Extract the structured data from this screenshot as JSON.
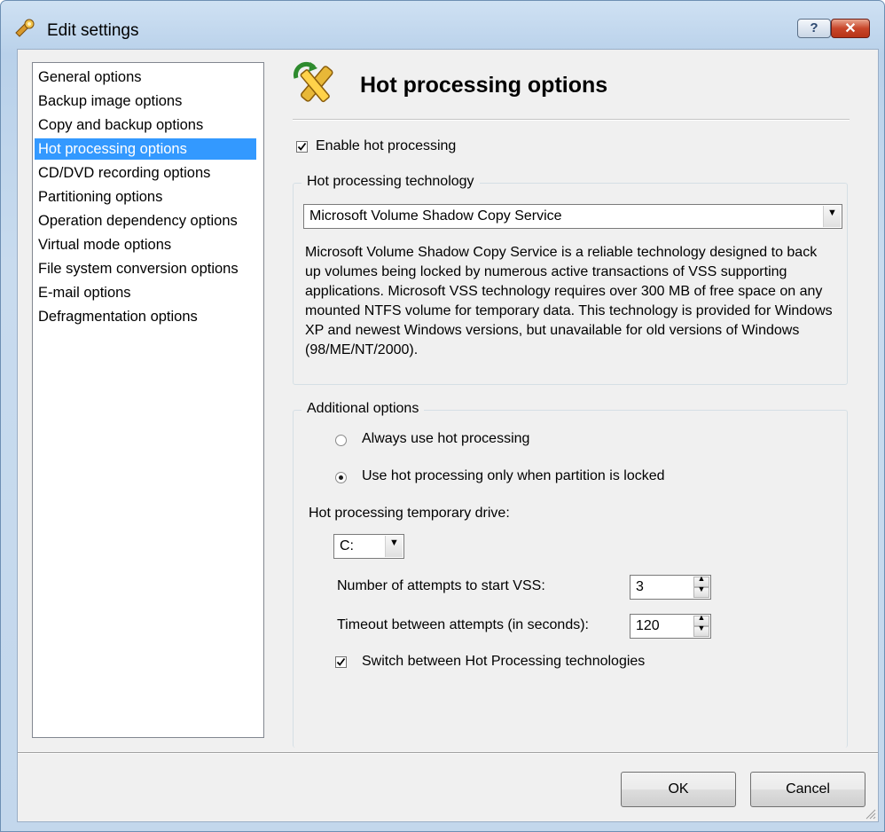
{
  "window": {
    "title": "Edit settings",
    "help_label": "?",
    "close_label": "✕"
  },
  "nav": {
    "items": [
      {
        "label": "General options",
        "selected": false
      },
      {
        "label": "Backup image options",
        "selected": false
      },
      {
        "label": "Copy and backup options",
        "selected": false
      },
      {
        "label": "Hot processing options",
        "selected": true
      },
      {
        "label": "CD/DVD recording options",
        "selected": false
      },
      {
        "label": "Partitioning options",
        "selected": false
      },
      {
        "label": "Operation dependency options",
        "selected": false
      },
      {
        "label": "Virtual mode options",
        "selected": false
      },
      {
        "label": "File system conversion options",
        "selected": false
      },
      {
        "label": "E-mail options",
        "selected": false
      },
      {
        "label": "Defragmentation options",
        "selected": false
      }
    ]
  },
  "header": {
    "title": "Hot processing options",
    "icon": "tools-wrench-pencil-icon"
  },
  "enable_hot_processing": {
    "label": "Enable hot processing",
    "checked": true
  },
  "technology": {
    "group_title": "Hot processing technology",
    "selected": "Microsoft Volume Shadow Copy Service",
    "description": "Microsoft Volume Shadow Copy Service is a reliable technology designed to back up volumes being locked by numerous active transactions of VSS supporting applications. Microsoft VSS technology requires over 300 MB of free space on any mounted NTFS volume for temporary data. This technology is provided for Windows XP and newest Windows versions, but unavailable for old versions of Windows (98/ME/NT/2000)."
  },
  "additional": {
    "group_title": "Additional options",
    "radio_always": {
      "label": "Always use hot processing",
      "selected": false
    },
    "radio_locked": {
      "label": "Use hot processing only when partition is locked",
      "selected": true
    },
    "temp_drive_label": "Hot processing temporary drive:",
    "temp_drive_value": "C:",
    "attempts_label": "Number of attempts to start VSS:",
    "attempts_value": "3",
    "timeout_label": "Timeout between attempts (in seconds):",
    "timeout_value": "120",
    "switch_tech": {
      "label": "Switch between Hot Processing technologies",
      "checked": true
    }
  },
  "buttons": {
    "ok": "OK",
    "cancel": "Cancel"
  }
}
